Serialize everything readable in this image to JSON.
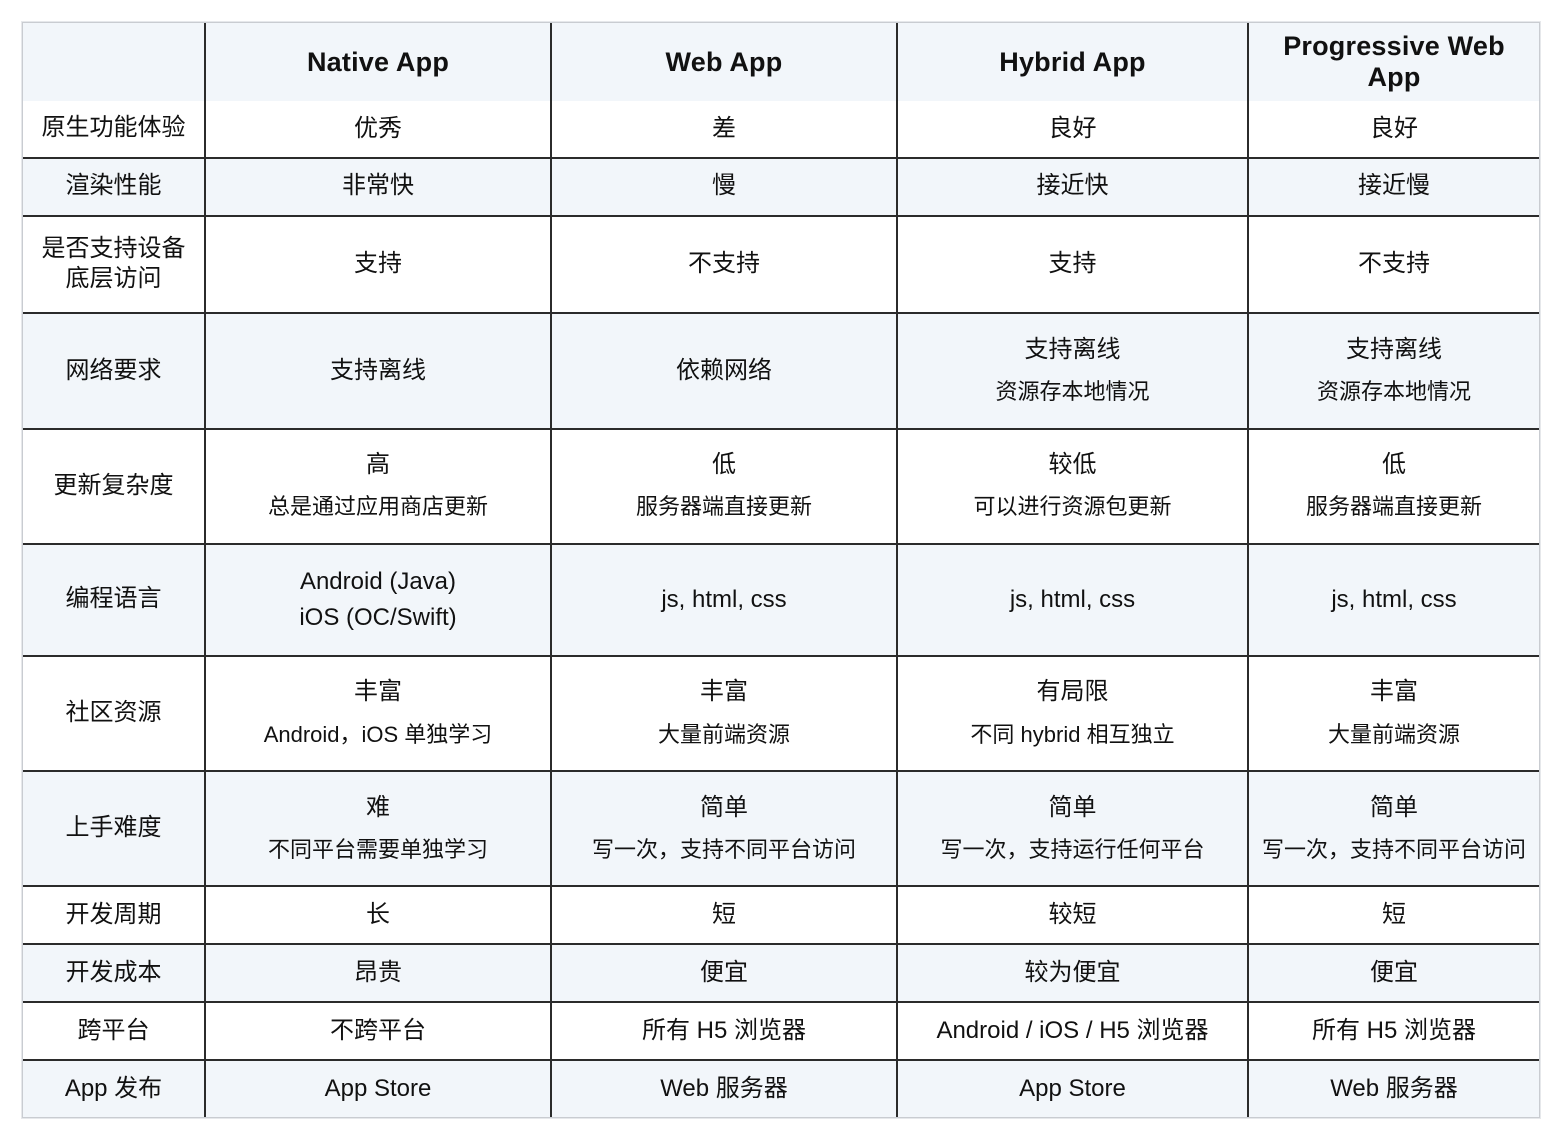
{
  "table": {
    "corner_label": "",
    "columns": [
      {
        "key": "label",
        "header": ""
      },
      {
        "key": "native",
        "header": "Native App"
      },
      {
        "key": "web",
        "header": "Web App"
      },
      {
        "key": "hybrid",
        "header": "Hybrid App"
      },
      {
        "key": "pwa",
        "header": "Progressive Web App"
      }
    ],
    "rows": [
      {
        "label": "原生功能体验",
        "shade": false,
        "cells": [
          {
            "main": "优秀"
          },
          {
            "main": "差"
          },
          {
            "main": "良好"
          },
          {
            "main": "良好"
          }
        ]
      },
      {
        "label": "渲染性能",
        "shade": true,
        "cells": [
          {
            "main": "非常快"
          },
          {
            "main": "慢"
          },
          {
            "main": "接近快"
          },
          {
            "main": "接近慢"
          }
        ]
      },
      {
        "label": "是否支持设备\n底层访问",
        "label_line1": "是否支持设备",
        "label_line2": "底层访问",
        "shade": false,
        "cells": [
          {
            "main": "支持"
          },
          {
            "main": "不支持"
          },
          {
            "main": "支持"
          },
          {
            "main": "不支持"
          }
        ]
      },
      {
        "label": "网络要求",
        "shade": true,
        "cells": [
          {
            "main": "支持离线"
          },
          {
            "main": "依赖网络"
          },
          {
            "main": "支持离线",
            "sub": "资源存本地情况"
          },
          {
            "main": "支持离线",
            "sub": "资源存本地情况"
          }
        ]
      },
      {
        "label": "更新复杂度",
        "shade": false,
        "cells": [
          {
            "main": "高",
            "sub": "总是通过应用商店更新"
          },
          {
            "main": "低",
            "sub": "服务器端直接更新"
          },
          {
            "main": "较低",
            "sub": "可以进行资源包更新"
          },
          {
            "main": "低",
            "sub": "服务器端直接更新"
          }
        ]
      },
      {
        "label": "编程语言",
        "shade": true,
        "cells": [
          {
            "main": "Android (Java)",
            "sub": "iOS (OC/Swift)",
            "equal": true
          },
          {
            "main": "js, html, css"
          },
          {
            "main": "js, html, css"
          },
          {
            "main": "js, html, css"
          }
        ]
      },
      {
        "label": "社区资源",
        "shade": false,
        "cells": [
          {
            "main": "丰富",
            "sub": "Android，iOS 单独学习"
          },
          {
            "main": "丰富",
            "sub": "大量前端资源"
          },
          {
            "main": "有局限",
            "sub": "不同 hybrid 相互独立"
          },
          {
            "main": "丰富",
            "sub": "大量前端资源"
          }
        ]
      },
      {
        "label": "上手难度",
        "shade": true,
        "cells": [
          {
            "main": "难",
            "sub": "不同平台需要单独学习"
          },
          {
            "main": "简单",
            "sub": "写一次，支持不同平台访问"
          },
          {
            "main": "简单",
            "sub": "写一次，支持运行任何平台"
          },
          {
            "main": "简单",
            "sub": "写一次，支持不同平台访问"
          }
        ]
      },
      {
        "label": "开发周期",
        "shade": false,
        "cells": [
          {
            "main": "长"
          },
          {
            "main": "短"
          },
          {
            "main": "较短"
          },
          {
            "main": "短"
          }
        ]
      },
      {
        "label": "开发成本",
        "shade": true,
        "cells": [
          {
            "main": "昂贵"
          },
          {
            "main": "便宜"
          },
          {
            "main": "较为便宜"
          },
          {
            "main": "便宜"
          }
        ]
      },
      {
        "label": "跨平台",
        "shade": false,
        "cells": [
          {
            "main": "不跨平台"
          },
          {
            "main": "所有 H5 浏览器"
          },
          {
            "main": "Android / iOS / H5 浏览器"
          },
          {
            "main": "所有 H5 浏览器"
          }
        ]
      },
      {
        "label": "App 发布",
        "shade": true,
        "cells": [
          {
            "main": "App Store"
          },
          {
            "main": "Web 服务器"
          },
          {
            "main": "App Store"
          },
          {
            "main": "Web 服务器"
          }
        ]
      }
    ]
  },
  "style": {
    "shade_color": "#f2f6fa",
    "plain_color": "#ffffff",
    "grid_color": "#2b2b2b",
    "frame_color": "#c9ccd1",
    "text_color": "#111111"
  }
}
